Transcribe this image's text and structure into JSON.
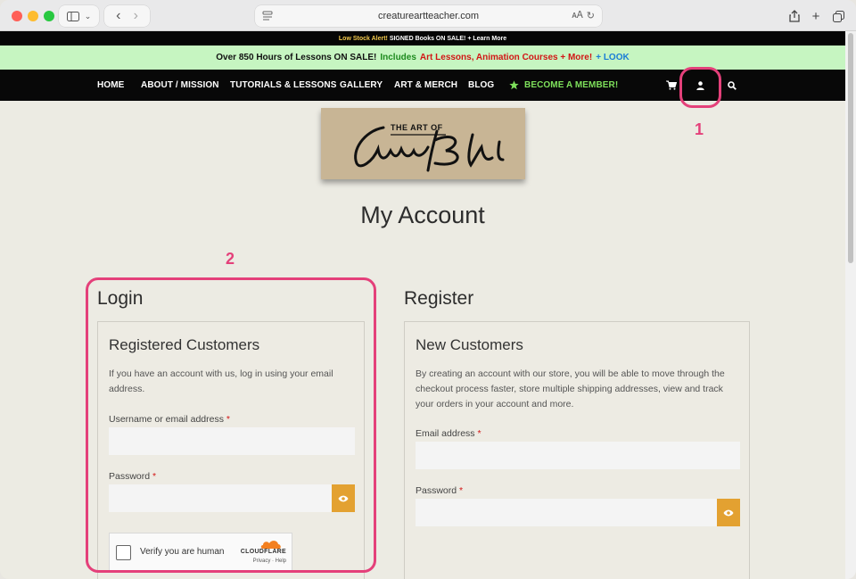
{
  "browser": {
    "url": "creatureartteacher.com"
  },
  "alert_bar": {
    "lead": "Low Stock Alert!",
    "text": "SIGNED Books ON SALE! + Learn More"
  },
  "promo_bar": {
    "part1": "Over 850 Hours of Lessons ON SALE!",
    "part2": "Includes",
    "part3": "Art Lessons, Animation Courses + More!",
    "part4": "+ LOOK"
  },
  "nav": {
    "items": [
      "HOME",
      "ABOUT / MISSION",
      "TUTORIALS & LESSONS",
      "GALLERY",
      "ART & MERCH",
      "BLOG"
    ],
    "member_label": "BECOME A MEMBER!"
  },
  "logo": {
    "text": "THE ART OF"
  },
  "page": {
    "title": "My Account"
  },
  "annotations": {
    "one": "1",
    "two": "2"
  },
  "login": {
    "heading": "Login",
    "card_title": "Registered Customers",
    "description": "If you have an account with us, log in using your email address.",
    "username_label": "Username or email address",
    "password_label": "Password",
    "required_mark": "*",
    "captcha_label": "Verify you are human",
    "captcha_brand": "CLOUDFLARE",
    "captcha_links": "Privacy · Help"
  },
  "register": {
    "heading": "Register",
    "card_title": "New Customers",
    "description": "By creating an account with our store, you will be able to move through the checkout process faster, store multiple shipping addresses, view and track your orders in your account and more.",
    "email_label": "Email address",
    "password_label": "Password",
    "required_mark": "*"
  },
  "colors": {
    "annotation": "#e4407a",
    "eye_button": "#e3a131",
    "member_green": "#7ee05b",
    "promo_bg": "#c6f5c1"
  },
  "icons": {
    "cart": "cart-icon",
    "account": "user-icon",
    "search": "search-icon",
    "eye": "eye-icon",
    "star": "star-icon"
  }
}
